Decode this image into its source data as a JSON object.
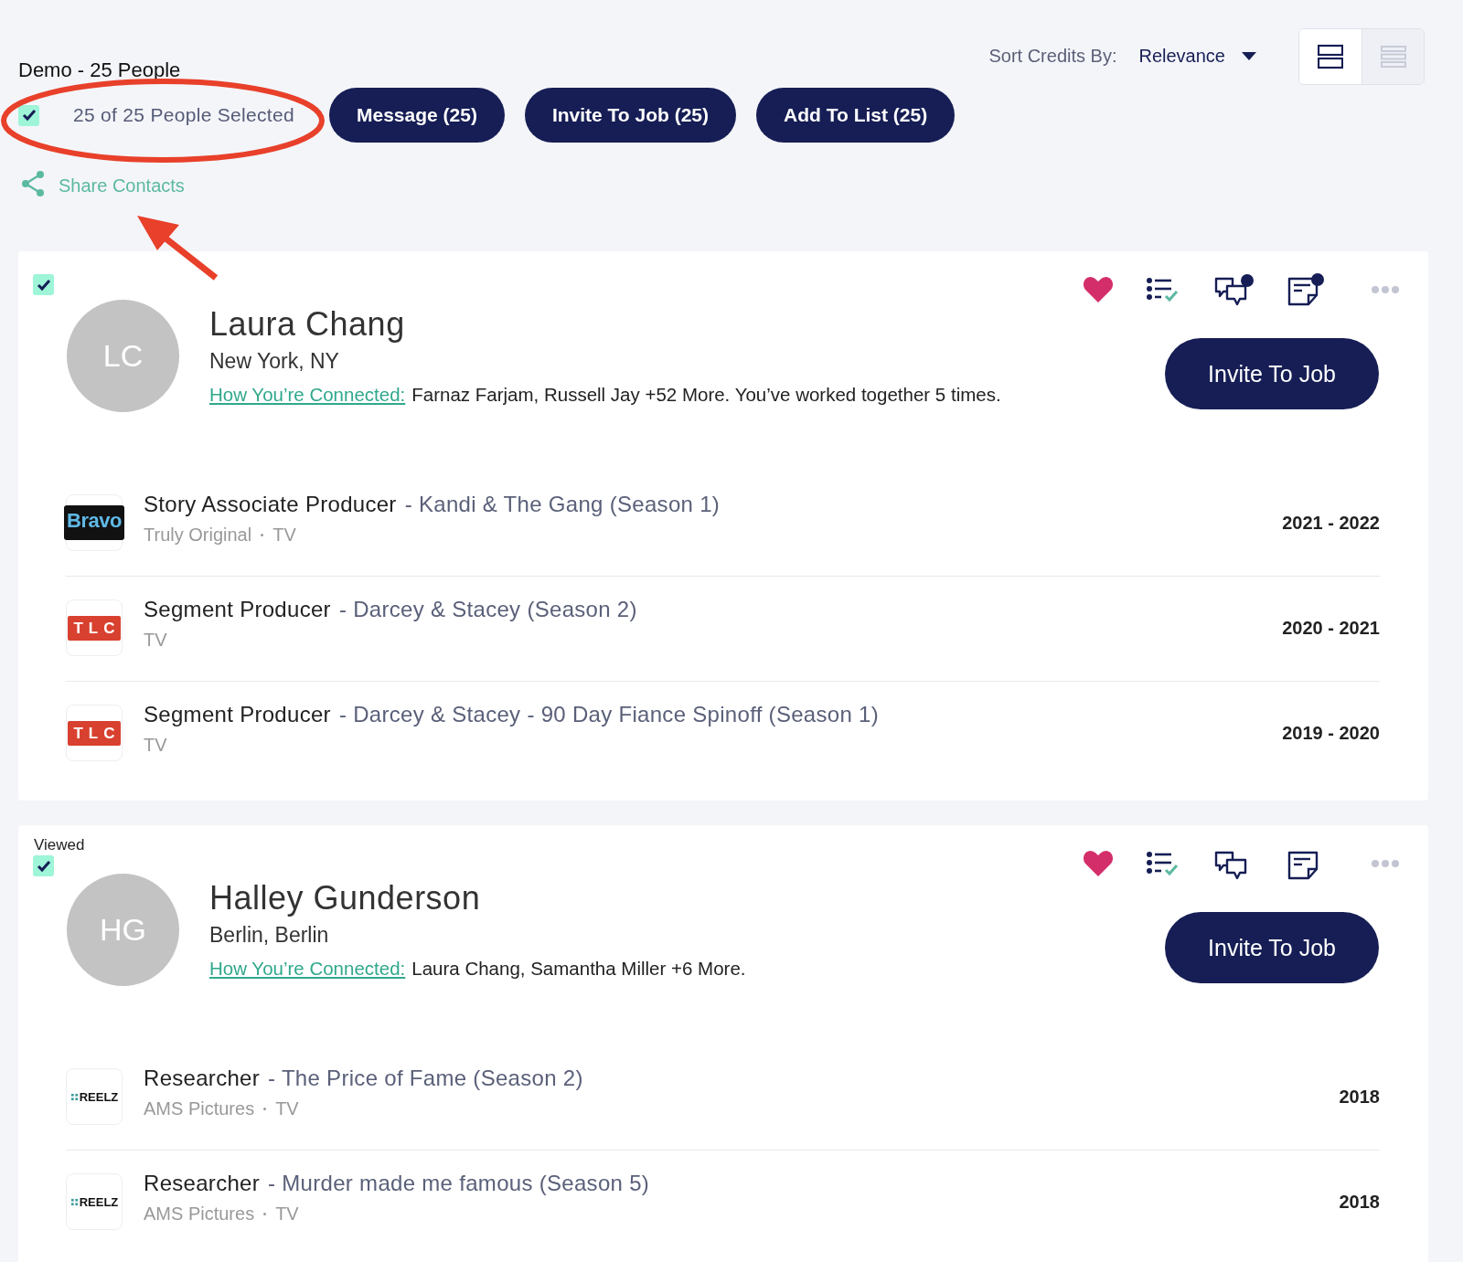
{
  "header": {
    "title": "Demo - 25 People",
    "sort_label": "Sort Credits By:",
    "sort_value": "Relevance",
    "view_toggle": [
      {
        "kind": "cards",
        "selected": true
      },
      {
        "kind": "list",
        "selected": false
      }
    ]
  },
  "selection": {
    "checked": true,
    "label": "25 of 25 People Selected"
  },
  "actions": [
    "Message (25)",
    "Invite To Job (25)",
    "Add To List (25)"
  ],
  "share": {
    "label": "Share Contacts"
  },
  "people": [
    {
      "checked": true,
      "initials": "LC",
      "name": "Laura Chang",
      "location": "New York, NY",
      "connected_label": "How You’re Connected:",
      "connected_text": "Farnaz Farjam, Russell Jay +52 More. You’ve worked together 5 times.",
      "favorite": true,
      "new_message": true,
      "new_note": true,
      "invite": "Invite To Job",
      "credits": [
        {
          "kind": "bravo",
          "logo_text": "Bravo",
          "role": "Story Associate Producer",
          "project": "- Kandi & The Gang (Season 1)",
          "meta": [
            "Truly Original",
            "TV"
          ],
          "years": "2021 - 2022"
        },
        {
          "kind": "tlc",
          "logo_text": "TLC",
          "role": "Segment Producer",
          "project": "- Darcey & Stacey (Season 2)",
          "meta": [
            "TV"
          ],
          "years": "2020 - 2021"
        },
        {
          "kind": "tlc",
          "logo_text": "TLC",
          "role": "Segment Producer",
          "project": "- Darcey & Stacey - 90 Day Fiance Spinoff (Season 1)",
          "meta": [
            "TV"
          ],
          "years": "2019 - 2020"
        }
      ]
    },
    {
      "badge": "Viewed",
      "checked": true,
      "initials": "HG",
      "name": "Halley Gunderson",
      "location": "Berlin, Berlin",
      "connected_label": "How You’re Connected:",
      "connected_text": "Laura Chang, Samantha Miller +6 More.",
      "favorite": true,
      "new_message": false,
      "new_note": false,
      "invite": "Invite To Job",
      "credits": [
        {
          "kind": "reelz",
          "logo_text": "REELZ",
          "role": "Researcher",
          "project": "- The Price of Fame (Season 2)",
          "meta": [
            "AMS Pictures",
            "TV"
          ],
          "years": "2018"
        },
        {
          "kind": "reelz",
          "logo_text": "REELZ",
          "role": "Researcher",
          "project": "- Murder made me famous (Season 5)",
          "meta": [
            "AMS Pictures",
            "TV"
          ],
          "years": "2018"
        }
      ]
    }
  ]
}
